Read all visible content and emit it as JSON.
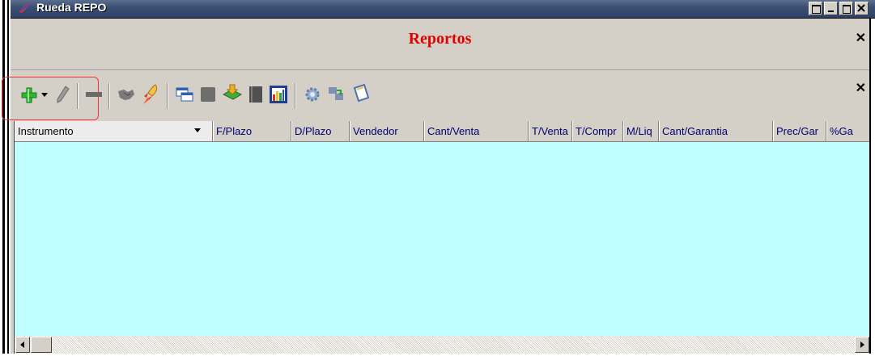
{
  "window": {
    "title": "Rueda REPO",
    "buttons": [
      "restore",
      "minimize",
      "maximize",
      "close"
    ]
  },
  "panel": {
    "title": "Reportos",
    "title_color": "#e00000"
  },
  "toolbar": {
    "icons": [
      "add-icon",
      "dropdown-arrow-icon",
      "edit-pencil-icon",
      "remove-icon",
      "handshake-icon",
      "rocket-icon",
      "copy-window-icon",
      "stop-icon",
      "export-icon",
      "notebook-icon",
      "bar-chart-icon",
      "settings-gear-icon",
      "refresh-arrows-icon",
      "clipboard-icon"
    ]
  },
  "grid": {
    "background": "#c0ffff",
    "columns": [
      {
        "label": "Instrumento"
      },
      {
        "label": "F/Plazo"
      },
      {
        "label": "D/Plazo"
      },
      {
        "label": "Vendedor"
      },
      {
        "label": "Cant/Venta"
      },
      {
        "label": "T/Venta"
      },
      {
        "label": "T/Compr"
      },
      {
        "label": "M/Liq"
      },
      {
        "label": "Cant/Garantia"
      },
      {
        "label": "Prec/Gar"
      },
      {
        "label": "%Ga"
      }
    ],
    "rows": []
  }
}
